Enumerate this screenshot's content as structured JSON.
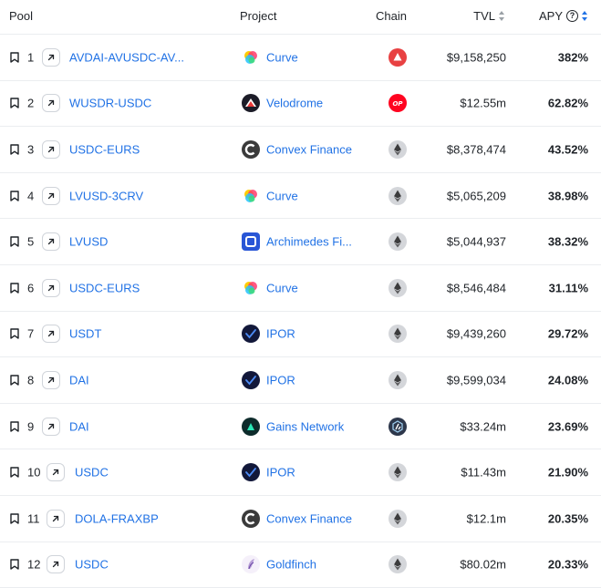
{
  "header": {
    "pool": "Pool",
    "project": "Project",
    "chain": "Chain",
    "tvl": "TVL",
    "apy": "APY",
    "apy_help": "?"
  },
  "colors": {
    "link": "#2172e5",
    "text": "#1f2328",
    "divider": "#ebedf0"
  },
  "rows": [
    {
      "rank": "1",
      "pool": "AVDAI-AVUSDC-AV...",
      "project": "Curve",
      "project_icon": "curve-logo",
      "chain_icon": "avalanche-icon",
      "tvl": "$9,158,250",
      "apy": "382%"
    },
    {
      "rank": "2",
      "pool": "WUSDR-USDC",
      "project": "Velodrome",
      "project_icon": "velodrome-logo",
      "chain_icon": "optimism-icon",
      "chain_label": "OP",
      "tvl": "$12.55m",
      "apy": "62.82%"
    },
    {
      "rank": "3",
      "pool": "USDC-EURS",
      "project": "Convex Finance",
      "project_icon": "convex-logo",
      "chain_icon": "ethereum-icon",
      "tvl": "$8,378,474",
      "apy": "43.52%"
    },
    {
      "rank": "4",
      "pool": "LVUSD-3CRV",
      "project": "Curve",
      "project_icon": "curve-logo",
      "chain_icon": "ethereum-icon",
      "tvl": "$5,065,209",
      "apy": "38.98%"
    },
    {
      "rank": "5",
      "pool": "LVUSD",
      "project": "Archimedes Fi...",
      "project_icon": "archimedes-logo",
      "chain_icon": "ethereum-icon",
      "tvl": "$5,044,937",
      "apy": "38.32%"
    },
    {
      "rank": "6",
      "pool": "USDC-EURS",
      "project": "Curve",
      "project_icon": "curve-logo",
      "chain_icon": "ethereum-icon",
      "tvl": "$8,546,484",
      "apy": "31.11%"
    },
    {
      "rank": "7",
      "pool": "USDT",
      "project": "IPOR",
      "project_icon": "ipor-logo",
      "chain_icon": "ethereum-icon",
      "tvl": "$9,439,260",
      "apy": "29.72%"
    },
    {
      "rank": "8",
      "pool": "DAI",
      "project": "IPOR",
      "project_icon": "ipor-logo",
      "chain_icon": "ethereum-icon",
      "tvl": "$9,599,034",
      "apy": "24.08%"
    },
    {
      "rank": "9",
      "pool": "DAI",
      "project": "Gains Network",
      "project_icon": "gains-logo",
      "chain_icon": "arbitrum-icon",
      "tvl": "$33.24m",
      "apy": "23.69%"
    },
    {
      "rank": "10",
      "pool": "USDC",
      "project": "IPOR",
      "project_icon": "ipor-logo",
      "chain_icon": "ethereum-icon",
      "tvl": "$11.43m",
      "apy": "21.90%"
    },
    {
      "rank": "11",
      "pool": "DOLA-FRAXBP",
      "project": "Convex Finance",
      "project_icon": "convex-logo",
      "chain_icon": "ethereum-icon",
      "tvl": "$12.1m",
      "apy": "20.35%"
    },
    {
      "rank": "12",
      "pool": "USDC",
      "project": "Goldfinch",
      "project_icon": "goldfinch-logo",
      "chain_icon": "ethereum-icon",
      "tvl": "$80.02m",
      "apy": "20.33%"
    }
  ]
}
